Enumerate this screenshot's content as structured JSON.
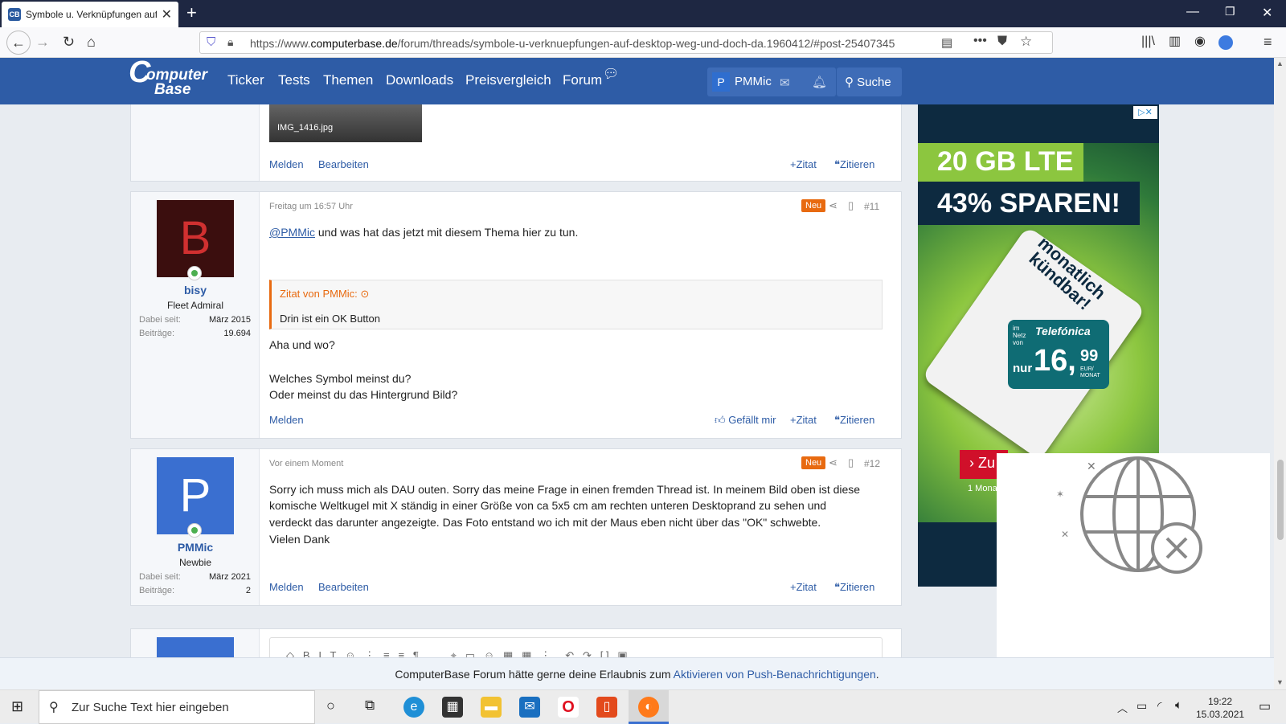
{
  "browser": {
    "tab_title": "Symbole u. Verknüpfungen auf",
    "url_prefix": "https://www.",
    "url_host": "computerbase.de",
    "url_path": "/forum/threads/symbole-u-verknuepfungen-auf-desktop-weg-und-doch-da.1960412/#post-25407345"
  },
  "site": {
    "logo_c": "C",
    "logo_t1": "omputer",
    "logo_t2": "Base",
    "nav": [
      "Ticker",
      "Tests",
      "Themen",
      "Downloads",
      "Preisvergleich",
      "Forum"
    ],
    "user_initial": "P",
    "user_name": "PMMic",
    "search_label": "Suche"
  },
  "prev_post": {
    "attachment_name": "IMG_1416.jpg",
    "actions": {
      "report": "Melden",
      "edit": "Bearbeiten",
      "plus_quote": "Zitat",
      "quote": "Zitieren"
    }
  },
  "post11": {
    "avatar_letter": "B",
    "username": "bisy",
    "user_title": "Fleet Admiral",
    "joined_label": "Dabei seit:",
    "joined_value": "März 2015",
    "posts_label": "Beiträge:",
    "posts_value": "19.694",
    "date": "Freitag um 16:57 Uhr",
    "badge": "Neu",
    "number": "#11",
    "mention": "@PMMic",
    "line1_rest": " und was hat das jetzt mit diesem Thema hier zu tun.",
    "quote_header": "Zitat von PMMic:",
    "quote_body": "Drin ist ein OK Button",
    "line2": "Aha und wo?",
    "line3": "Welches Symbol meinst du?",
    "line4": "Oder meinst du das Hintergrund Bild?",
    "actions": {
      "report": "Melden",
      "like": "Gefällt mir",
      "plus_quote": "Zitat",
      "quote": "Zitieren"
    }
  },
  "post12": {
    "avatar_letter": "P",
    "username": "PMMic",
    "user_title": "Newbie",
    "joined_label": "Dabei seit:",
    "joined_value": "März 2021",
    "posts_label": "Beiträge:",
    "posts_value": "2",
    "date": "Vor einem Moment",
    "badge": "Neu",
    "number": "#12",
    "lines": [
      "Sorry ich muss mich als DAU outen. Sorry das meine Frage in einen fremden Thread ist. In meinem Bild oben ist diese",
      "komische Weltkugel mit X ständig in einer Größe von ca 5x5 cm am rechten unteren Desktoprand zu sehen und",
      "verdeckt das darunter angezeigte. Das Foto entstand wo ich mit der Maus eben nicht über das \"OK\" schwebte.",
      "Vielen Dank"
    ],
    "actions": {
      "report": "Melden",
      "edit": "Bearbeiten",
      "plus_quote": "Zitat",
      "quote": "Zitieren"
    }
  },
  "ad": {
    "line1": "20 GB LTE",
    "line2": "43% SPAREN!",
    "sim_text_1": "monatlich",
    "sim_text_2": "kündbar!",
    "network_small": "im Netz von",
    "network": "Telefónica",
    "price_prefix": "nur",
    "price_main": "16,",
    "price_cents": "99",
    "price_unit": "EUR/ MONAT",
    "button": "› Zu",
    "small": "1 Mona"
  },
  "push_bar": {
    "text_before": "ComputerBase Forum hätte gerne deine Erlaubnis zum ",
    "link": "Aktivieren von Push-Benachrichtigungen",
    "text_after": "."
  },
  "taskbar": {
    "search_placeholder": "Zur Suche Text hier eingeben",
    "time": "19:22",
    "date": "15.03.2021"
  }
}
